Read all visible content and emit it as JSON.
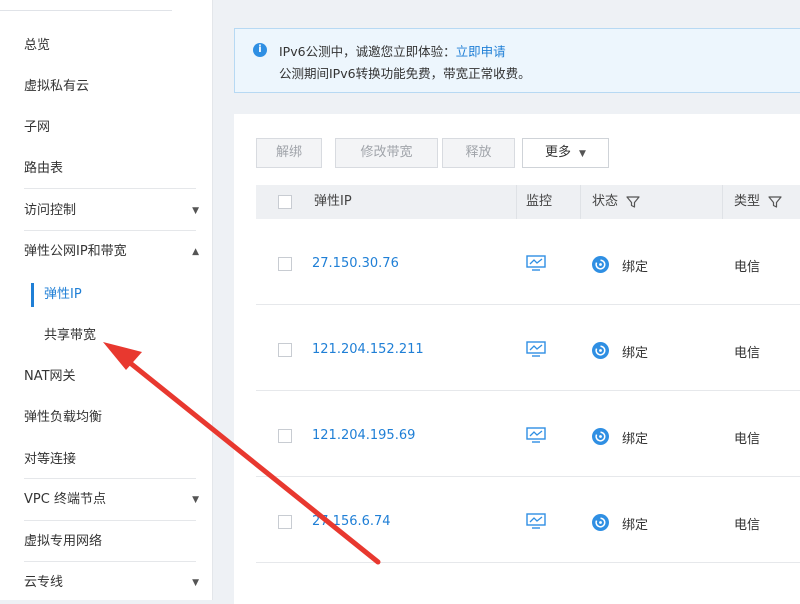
{
  "sidebar": {
    "items": [
      {
        "label": "总览"
      },
      {
        "label": "虚拟私有云"
      },
      {
        "label": "子网"
      },
      {
        "label": "路由表"
      },
      {
        "label": "访问控制"
      },
      {
        "label": "弹性公网IP和带宽"
      },
      {
        "label": "NAT网关"
      },
      {
        "label": "弹性负载均衡"
      },
      {
        "label": "对等连接"
      },
      {
        "label": "VPC 终端节点"
      },
      {
        "label": "虚拟专用网络"
      },
      {
        "label": "云专线"
      }
    ],
    "subitems": [
      {
        "label": "弹性IP"
      },
      {
        "label": "共享带宽"
      }
    ]
  },
  "notice": {
    "line1_prefix": "IPv6公测中，诚邀您立即体验：",
    "line1_link": "立即申请",
    "line2": "公测期间IPv6转换功能免费，带宽正常收费。"
  },
  "toolbar": {
    "unbind": "解绑",
    "modify_bandwidth": "修改带宽",
    "release": "释放",
    "more": "更多"
  },
  "table": {
    "headers": {
      "ip": "弹性IP",
      "monitor": "监控",
      "status": "状态",
      "type": "类型"
    },
    "rows": [
      {
        "ip": "27.150.30.76",
        "status": "绑定",
        "type": "电信"
      },
      {
        "ip": "121.204.152.211",
        "status": "绑定",
        "type": "电信"
      },
      {
        "ip": "121.204.195.69",
        "status": "绑定",
        "type": "电信"
      },
      {
        "ip": "27.156.6.74",
        "status": "绑定",
        "type": "电信"
      }
    ]
  },
  "colors": {
    "accent": "#1f7fd6",
    "annotation_arrow": "#e8382f"
  },
  "icons": [
    "info-icon",
    "filter-icon",
    "monitor-icon",
    "bind-status-icon",
    "chevron-down-icon",
    "chevron-up-icon"
  ]
}
